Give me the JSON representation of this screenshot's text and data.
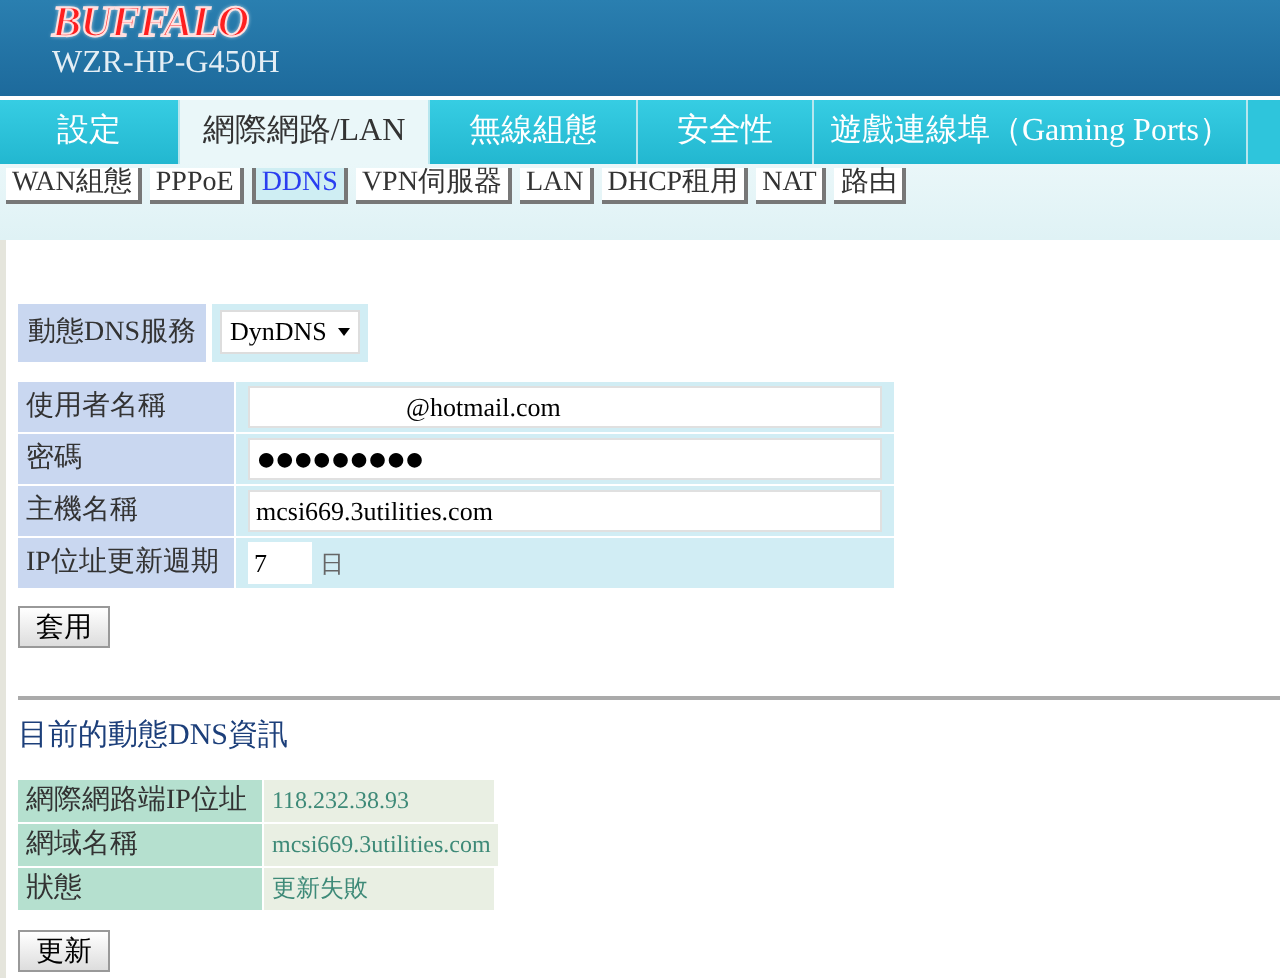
{
  "brand": {
    "logo": "BUFFALO",
    "model": "WZR-HP-G450H"
  },
  "tabs": [
    {
      "label": "設定",
      "selected": false
    },
    {
      "label": "網際網路/LAN",
      "selected": true
    },
    {
      "label": "無線組態",
      "selected": false
    },
    {
      "label": "安全性",
      "selected": false
    },
    {
      "label": "遊戲連線埠（Gaming Ports）",
      "selected": false
    }
  ],
  "subtabs": [
    {
      "label": "WAN組態",
      "selected": false
    },
    {
      "label": "PPPoE",
      "selected": false
    },
    {
      "label": "DDNS",
      "selected": true
    },
    {
      "label": "VPN伺服器",
      "selected": false
    },
    {
      "label": "LAN",
      "selected": false
    },
    {
      "label": "DHCP租用",
      "selected": false
    },
    {
      "label": "NAT",
      "selected": false
    },
    {
      "label": "路由",
      "selected": false
    }
  ],
  "service": {
    "label": "動態DNS服務",
    "value": "DynDNS"
  },
  "form": [
    {
      "label": "使用者名稱",
      "value": "@hotmail.com",
      "kind": "text"
    },
    {
      "label": "密碼",
      "value": "●●●●●●●●●",
      "kind": "password"
    },
    {
      "label": "主機名稱",
      "value": "mcsi669.3utilities.com",
      "kind": "text"
    },
    {
      "label": "IP位址更新週期",
      "value": "7",
      "unit": "日",
      "kind": "short"
    }
  ],
  "apply_button": "套用",
  "info": {
    "title": "目前的動態DNS資訊",
    "rows": [
      {
        "label": "網際網路端IP位址",
        "value": "118.232.38.93"
      },
      {
        "label": "網域名稱",
        "value": "mcsi669.3utilities.com"
      },
      {
        "label": "狀態",
        "value": "更新失敗"
      }
    ]
  },
  "refresh_button": "更新"
}
